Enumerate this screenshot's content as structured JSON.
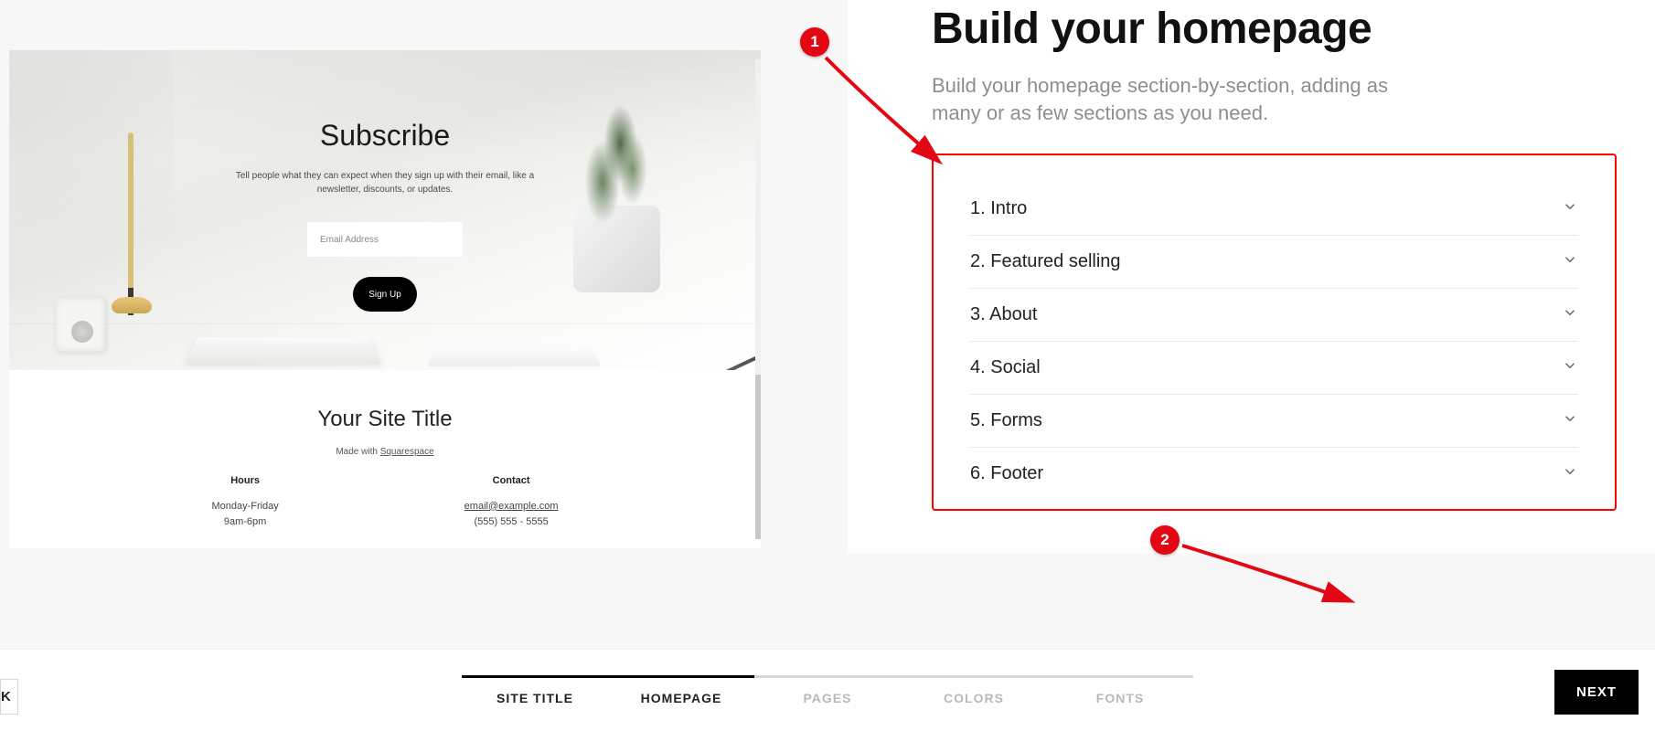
{
  "preview": {
    "subscribe_heading": "Subscribe",
    "subscribe_sub": "Tell people what they can expect when they sign up with their email, like a newsletter, discounts, or updates.",
    "email_placeholder": "Email Address",
    "signup_label": "Sign Up",
    "site_title": "Your Site Title",
    "made_with_prefix": "Made with ",
    "made_with_link": "Squarespace",
    "hours_header": "Hours",
    "hours_line1": "Monday-Friday",
    "hours_line2": "9am-6pm",
    "contact_header": "Contact",
    "contact_email": "email@example.com",
    "contact_phone": "(555) 555 - 5555"
  },
  "config": {
    "title": "Build your homepage",
    "desc": "Build your homepage section-by-section, adding as many or as few sections as you need.",
    "sections": [
      {
        "label": "1. Intro"
      },
      {
        "label": "2. Featured selling"
      },
      {
        "label": "3. About"
      },
      {
        "label": "4. Social"
      },
      {
        "label": "5. Forms"
      },
      {
        "label": "6. Footer"
      }
    ]
  },
  "nav": {
    "back_label": "K",
    "next_label": "NEXT",
    "steps": [
      {
        "label": "SITE TITLE",
        "state": "done"
      },
      {
        "label": "HOMEPAGE",
        "state": "active"
      },
      {
        "label": "PAGES",
        "state": "future"
      },
      {
        "label": "COLORS",
        "state": "future"
      },
      {
        "label": "FONTS",
        "state": "future"
      }
    ]
  },
  "annotations": {
    "badge1": "1",
    "badge2": "2"
  }
}
